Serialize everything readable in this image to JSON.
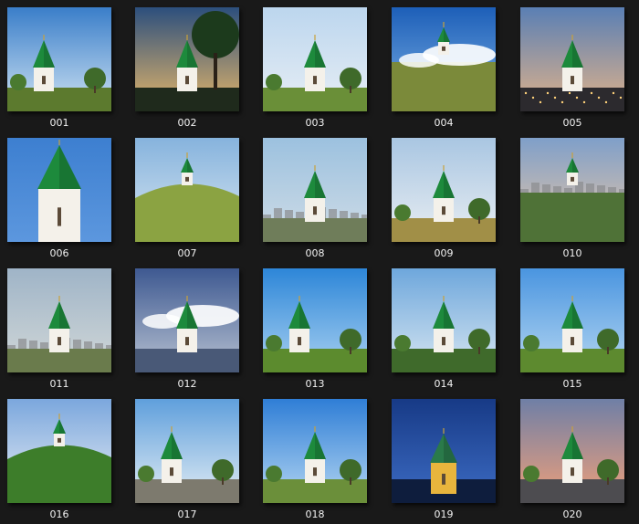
{
  "window": {
    "background": "#191919",
    "label_color": "#f2f2f2"
  },
  "thumbnails": [
    {
      "label": "001",
      "sky_top": "#3a7ec9",
      "sky_bottom": "#cfe3f3",
      "ground": "#5c7a2e",
      "variant": "side",
      "extra": "trees"
    },
    {
      "label": "002",
      "sky_top": "#2c4f7d",
      "sky_bottom": "#e6b769",
      "ground": "#1f2a1c",
      "variant": "center",
      "extra": "bigtree"
    },
    {
      "label": "003",
      "sky_top": "#bcd6ee",
      "sky_bottom": "#e7eef5",
      "ground": "#6a8f38",
      "variant": "center",
      "extra": "trees"
    },
    {
      "label": "004",
      "sky_top": "#1d5fb8",
      "sky_bottom": "#7eb2e6",
      "ground": "#7b8a3a",
      "variant": "small",
      "extra": "clouds"
    },
    {
      "label": "005",
      "sky_top": "#5a7fb4",
      "sky_bottom": "#e1b38a",
      "ground": "#2c2a2e",
      "variant": "center",
      "extra": "lights"
    },
    {
      "label": "006",
      "sky_top": "#3d7fd0",
      "sky_bottom": "#5c97de",
      "ground": "#3d7fd0",
      "variant": "closeup",
      "extra": "none"
    },
    {
      "label": "007",
      "sky_top": "#86b3dd",
      "sky_bottom": "#d8e6f1",
      "ground": "#8ba342",
      "variant": "small",
      "extra": "hill"
    },
    {
      "label": "008",
      "sky_top": "#9cc1df",
      "sky_bottom": "#cfdce6",
      "ground": "#6f7d5a",
      "variant": "center",
      "extra": "city"
    },
    {
      "label": "009",
      "sky_top": "#a9c6e2",
      "sky_bottom": "#e9eef2",
      "ground": "#a18f47",
      "variant": "center",
      "extra": "trees"
    },
    {
      "label": "010",
      "sky_top": "#7f9fc9",
      "sky_bottom": "#ebc8a6",
      "ground": "#4f7237",
      "variant": "small",
      "extra": "city"
    },
    {
      "label": "011",
      "sky_top": "#9fb4c7",
      "sky_bottom": "#d2d8d8",
      "ground": "#6a7b4c",
      "variant": "center",
      "extra": "city"
    },
    {
      "label": "012",
      "sky_top": "#3e5991",
      "sky_bottom": "#b8c2d2",
      "ground": "#495977",
      "variant": "center",
      "extra": "clouds"
    },
    {
      "label": "013",
      "sky_top": "#2d86d8",
      "sky_bottom": "#a9d1f1",
      "ground": "#5c8b2e",
      "variant": "side",
      "extra": "trees"
    },
    {
      "label": "014",
      "sky_top": "#6ea7dc",
      "sky_bottom": "#d7e6f1",
      "ground": "#3f6a2b",
      "variant": "center",
      "extra": "trees"
    },
    {
      "label": "015",
      "sky_top": "#4a95e0",
      "sky_bottom": "#b4d6f1",
      "ground": "#5d8a2f",
      "variant": "center",
      "extra": "trees"
    },
    {
      "label": "016",
      "sky_top": "#7ba7dd",
      "sky_bottom": "#e9eef4",
      "ground": "#3d7d2a",
      "variant": "small",
      "extra": "hill"
    },
    {
      "label": "017",
      "sky_top": "#5f9fdc",
      "sky_bottom": "#e3edf4",
      "ground": "#7d7a6e",
      "variant": "side",
      "extra": "trees"
    },
    {
      "label": "018",
      "sky_top": "#2f7ed6",
      "sky_bottom": "#b4d6f2",
      "ground": "#6b8f3a",
      "variant": "center",
      "extra": "trees"
    },
    {
      "label": "019",
      "sky_top": "#173a86",
      "sky_bottom": "#3d6cc4",
      "ground": "#0e1d3d",
      "variant": "night",
      "extra": "none"
    },
    {
      "label": "020",
      "sky_top": "#6f7fa6",
      "sky_bottom": "#f0a07a",
      "ground": "#4d4c50",
      "variant": "center",
      "extra": "trees"
    }
  ]
}
